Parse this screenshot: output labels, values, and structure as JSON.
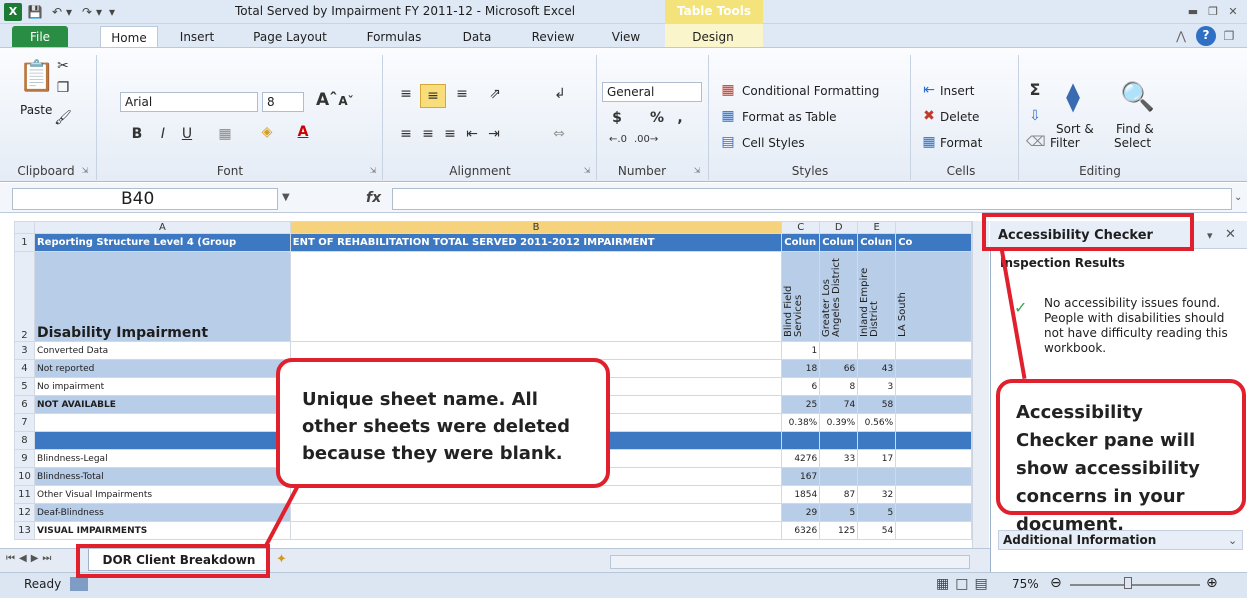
{
  "titlebar": {
    "app_icon": "X",
    "document_title": "Total Served by Impairment FY 2011-12  -  Microsoft Excel",
    "context_tab_group": "Table Tools"
  },
  "ribbon_tabs": [
    "File",
    "Home",
    "Insert",
    "Page Layout",
    "Formulas",
    "Data",
    "Review",
    "View",
    "Design"
  ],
  "ribbon": {
    "clipboard": {
      "paste": "Paste",
      "group": "Clipboard"
    },
    "font": {
      "font_name": "Arial",
      "font_size": "8",
      "bold": "B",
      "italic": "I",
      "underline": "U",
      "group": "Font"
    },
    "alignment": {
      "group": "Alignment"
    },
    "number": {
      "format": "General",
      "currency": "$",
      "percent": "%",
      "comma": ",",
      "group": "Number"
    },
    "styles": {
      "conditional": "Conditional Formatting",
      "format_table": "Format as Table",
      "cell_styles": "Cell Styles",
      "group": "Styles"
    },
    "cells": {
      "insert": "Insert",
      "delete": "Delete",
      "format": "Format",
      "group": "Cells"
    },
    "editing": {
      "sum": "Σ",
      "sort": "Sort &",
      "sort2": "Filter",
      "find": "Find &",
      "find2": "Select",
      "group": "Editing"
    }
  },
  "formula_bar": {
    "name_box": "B40",
    "fx": "fx",
    "value": ""
  },
  "sheet": {
    "col_headers": [
      "A",
      "B",
      "C",
      "D",
      "E",
      ""
    ],
    "header_row": {
      "a": "Reporting Structure Level 4 (Group",
      "b": "ENT OF REHABILITATION     TOTAL SERVED 2011-2012          IMPAIRMENT",
      "c": "Colun",
      "d": "Colun",
      "e": "Colun",
      "f": "Co"
    },
    "row2": {
      "a": "Disability Impairment",
      "c": "Blind Field Services",
      "d": "Greater Los Angeles District",
      "e": "Inland Empire District",
      "f": "LA South"
    },
    "rows": [
      {
        "n": "3",
        "a": "Converted Data",
        "c": "1",
        "d": "",
        "e": ""
      },
      {
        "n": "4",
        "a": "Not reported",
        "c": "18",
        "d": "66",
        "e": "43"
      },
      {
        "n": "5",
        "a": "No impairment",
        "c": "6",
        "d": "8",
        "e": "3"
      },
      {
        "n": "6",
        "a": "NOT AVAILABLE",
        "c": "25",
        "d": "74",
        "e": "58"
      },
      {
        "n": "7",
        "a": "",
        "c": "0.38%",
        "d": "0.39%",
        "e": "0.56%"
      },
      {
        "n": "8",
        "a": "",
        "c": "",
        "d": "",
        "e": ""
      },
      {
        "n": "9",
        "a": "Blindness-Legal",
        "c": "4276",
        "d": "33",
        "e": "17"
      },
      {
        "n": "10",
        "a": "Blindness-Total",
        "c": "167",
        "d": "",
        "e": ""
      },
      {
        "n": "11",
        "a": "Other Visual Impairments",
        "c": "1854",
        "d": "87",
        "e": "32"
      },
      {
        "n": "12",
        "a": "Deaf-Blindness",
        "c": "29",
        "d": "5",
        "e": "5"
      },
      {
        "n": "13",
        "a": "VISUAL IMPAIRMENTS",
        "c": "6326",
        "d": "125",
        "e": "54"
      }
    ],
    "row_numbers": [
      "1",
      "2"
    ]
  },
  "sheet_tab": "DOR Client Breakdown",
  "status": {
    "ready": "Ready",
    "zoom": "75%"
  },
  "pane": {
    "title": "Accessibility Checker",
    "section": "Inspection Results",
    "message": "No accessibility issues found. People with disabilities should not have difficulty reading this workbook.",
    "additional": "Additional Information"
  },
  "callouts": {
    "sheet_name": "Unique sheet name. All other sheets were deleted because they were blank.",
    "pane": "Accessibility Checker pane will show accessibility concerns in your document."
  },
  "colors": {
    "accent_red": "#e0202c",
    "table_header_blue": "#3d79c3",
    "band_blue": "#b8cde8",
    "excel_green": "#1d7a35"
  }
}
